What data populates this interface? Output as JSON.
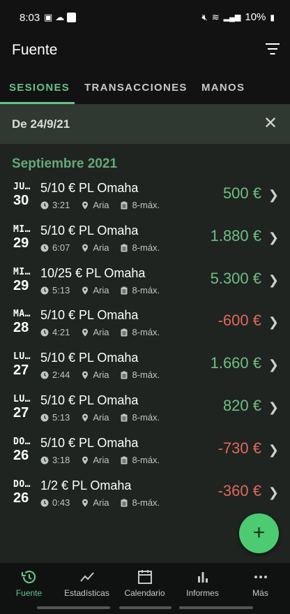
{
  "status_bar": {
    "time": "8:03",
    "battery": "10%",
    "u_badge": "U"
  },
  "app_bar": {
    "title": "Fuente",
    "filter_icon": "filter-lines-icon"
  },
  "tabs": [
    {
      "label": "SESIONES",
      "active": true
    },
    {
      "label": "TRANSACCIONES",
      "active": false
    },
    {
      "label": "MANOS",
      "active": false
    }
  ],
  "filter_chip": {
    "label": "De 24/9/21",
    "close_icon": "close-icon"
  },
  "month_header": "Septiembre 2021",
  "sessions": [
    {
      "dow": "JU…",
      "day": "30",
      "title": "5/10 € PL Omaha",
      "duration": "3:21",
      "location": "Aria",
      "seats": "8-máx.",
      "amount": "500 €",
      "sign": "pos"
    },
    {
      "dow": "MI…",
      "day": "29",
      "title": "5/10 € PL Omaha",
      "duration": "6:07",
      "location": "Aria",
      "seats": "8-máx.",
      "amount": "1.880 €",
      "sign": "pos"
    },
    {
      "dow": "MI…",
      "day": "29",
      "title": "10/25 € PL Omaha",
      "duration": "5:13",
      "location": "Aria",
      "seats": "8-máx.",
      "amount": "5.300 €",
      "sign": "pos"
    },
    {
      "dow": "MA…",
      "day": "28",
      "title": "5/10 € PL Omaha",
      "duration": "4:21",
      "location": "Aria",
      "seats": "8-máx.",
      "amount": "-600 €",
      "sign": "neg"
    },
    {
      "dow": "LU…",
      "day": "27",
      "title": "5/10 € PL Omaha",
      "duration": "2:44",
      "location": "Aria",
      "seats": "8-máx.",
      "amount": "1.660 €",
      "sign": "pos"
    },
    {
      "dow": "LU…",
      "day": "27",
      "title": "5/10 € PL Omaha",
      "duration": "5:13",
      "location": "Aria",
      "seats": "8-máx.",
      "amount": "820 €",
      "sign": "pos"
    },
    {
      "dow": "DO…",
      "day": "26",
      "title": "5/10 € PL Omaha",
      "duration": "3:18",
      "location": "Aria",
      "seats": "8-máx.",
      "amount": "-730 €",
      "sign": "neg"
    },
    {
      "dow": "DO…",
      "day": "26",
      "title": "1/2 € PL Omaha",
      "duration": "0:43",
      "location": "Aria",
      "seats": "8-máx.",
      "amount": "-360 €",
      "sign": "neg"
    }
  ],
  "fab": {
    "label": "+"
  },
  "bottom_nav": [
    {
      "label": "Fuente",
      "icon": "history-icon",
      "active": true
    },
    {
      "label": "Estadísticas",
      "icon": "trend-chart-icon",
      "active": false
    },
    {
      "label": "Calendario",
      "icon": "calendar-icon",
      "active": false
    },
    {
      "label": "Informes",
      "icon": "bar-chart-icon",
      "active": false
    },
    {
      "label": "Más",
      "icon": "more-dots-icon",
      "active": false
    }
  ],
  "colors": {
    "accent": "#66c28a",
    "positive": "#6fbe85",
    "negative": "#e0685e",
    "fab": "#4ccb72"
  }
}
